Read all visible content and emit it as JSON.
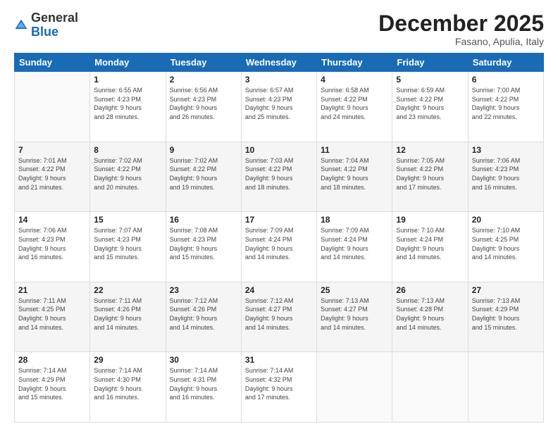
{
  "logo": {
    "general": "General",
    "blue": "Blue"
  },
  "header": {
    "month": "December 2025",
    "location": "Fasano, Apulia, Italy"
  },
  "weekdays": [
    "Sunday",
    "Monday",
    "Tuesday",
    "Wednesday",
    "Thursday",
    "Friday",
    "Saturday"
  ],
  "weeks": [
    [
      {
        "day": "",
        "info": ""
      },
      {
        "day": "1",
        "info": "Sunrise: 6:55 AM\nSunset: 4:23 PM\nDaylight: 9 hours\nand 28 minutes."
      },
      {
        "day": "2",
        "info": "Sunrise: 6:56 AM\nSunset: 4:23 PM\nDaylight: 9 hours\nand 26 minutes."
      },
      {
        "day": "3",
        "info": "Sunrise: 6:57 AM\nSunset: 4:23 PM\nDaylight: 9 hours\nand 25 minutes."
      },
      {
        "day": "4",
        "info": "Sunrise: 6:58 AM\nSunset: 4:22 PM\nDaylight: 9 hours\nand 24 minutes."
      },
      {
        "day": "5",
        "info": "Sunrise: 6:59 AM\nSunset: 4:22 PM\nDaylight: 9 hours\nand 23 minutes."
      },
      {
        "day": "6",
        "info": "Sunrise: 7:00 AM\nSunset: 4:22 PM\nDaylight: 9 hours\nand 22 minutes."
      }
    ],
    [
      {
        "day": "7",
        "info": "Sunrise: 7:01 AM\nSunset: 4:22 PM\nDaylight: 9 hours\nand 21 minutes."
      },
      {
        "day": "8",
        "info": "Sunrise: 7:02 AM\nSunset: 4:22 PM\nDaylight: 9 hours\nand 20 minutes."
      },
      {
        "day": "9",
        "info": "Sunrise: 7:02 AM\nSunset: 4:22 PM\nDaylight: 9 hours\nand 19 minutes."
      },
      {
        "day": "10",
        "info": "Sunrise: 7:03 AM\nSunset: 4:22 PM\nDaylight: 9 hours\nand 18 minutes."
      },
      {
        "day": "11",
        "info": "Sunrise: 7:04 AM\nSunset: 4:22 PM\nDaylight: 9 hours\nand 18 minutes."
      },
      {
        "day": "12",
        "info": "Sunrise: 7:05 AM\nSunset: 4:22 PM\nDaylight: 9 hours\nand 17 minutes."
      },
      {
        "day": "13",
        "info": "Sunrise: 7:06 AM\nSunset: 4:23 PM\nDaylight: 9 hours\nand 16 minutes."
      }
    ],
    [
      {
        "day": "14",
        "info": "Sunrise: 7:06 AM\nSunset: 4:23 PM\nDaylight: 9 hours\nand 16 minutes."
      },
      {
        "day": "15",
        "info": "Sunrise: 7:07 AM\nSunset: 4:23 PM\nDaylight: 9 hours\nand 15 minutes."
      },
      {
        "day": "16",
        "info": "Sunrise: 7:08 AM\nSunset: 4:23 PM\nDaylight: 9 hours\nand 15 minutes."
      },
      {
        "day": "17",
        "info": "Sunrise: 7:09 AM\nSunset: 4:24 PM\nDaylight: 9 hours\nand 14 minutes."
      },
      {
        "day": "18",
        "info": "Sunrise: 7:09 AM\nSunset: 4:24 PM\nDaylight: 9 hours\nand 14 minutes."
      },
      {
        "day": "19",
        "info": "Sunrise: 7:10 AM\nSunset: 4:24 PM\nDaylight: 9 hours\nand 14 minutes."
      },
      {
        "day": "20",
        "info": "Sunrise: 7:10 AM\nSunset: 4:25 PM\nDaylight: 9 hours\nand 14 minutes."
      }
    ],
    [
      {
        "day": "21",
        "info": "Sunrise: 7:11 AM\nSunset: 4:25 PM\nDaylight: 9 hours\nand 14 minutes."
      },
      {
        "day": "22",
        "info": "Sunrise: 7:11 AM\nSunset: 4:26 PM\nDaylight: 9 hours\nand 14 minutes."
      },
      {
        "day": "23",
        "info": "Sunrise: 7:12 AM\nSunset: 4:26 PM\nDaylight: 9 hours\nand 14 minutes."
      },
      {
        "day": "24",
        "info": "Sunrise: 7:12 AM\nSunset: 4:27 PM\nDaylight: 9 hours\nand 14 minutes."
      },
      {
        "day": "25",
        "info": "Sunrise: 7:13 AM\nSunset: 4:27 PM\nDaylight: 9 hours\nand 14 minutes."
      },
      {
        "day": "26",
        "info": "Sunrise: 7:13 AM\nSunset: 4:28 PM\nDaylight: 9 hours\nand 14 minutes."
      },
      {
        "day": "27",
        "info": "Sunrise: 7:13 AM\nSunset: 4:29 PM\nDaylight: 9 hours\nand 15 minutes."
      }
    ],
    [
      {
        "day": "28",
        "info": "Sunrise: 7:14 AM\nSunset: 4:29 PM\nDaylight: 9 hours\nand 15 minutes."
      },
      {
        "day": "29",
        "info": "Sunrise: 7:14 AM\nSunset: 4:30 PM\nDaylight: 9 hours\nand 16 minutes."
      },
      {
        "day": "30",
        "info": "Sunrise: 7:14 AM\nSunset: 4:31 PM\nDaylight: 9 hours\nand 16 minutes."
      },
      {
        "day": "31",
        "info": "Sunrise: 7:14 AM\nSunset: 4:32 PM\nDaylight: 9 hours\nand 17 minutes."
      },
      {
        "day": "",
        "info": ""
      },
      {
        "day": "",
        "info": ""
      },
      {
        "day": "",
        "info": ""
      }
    ]
  ]
}
